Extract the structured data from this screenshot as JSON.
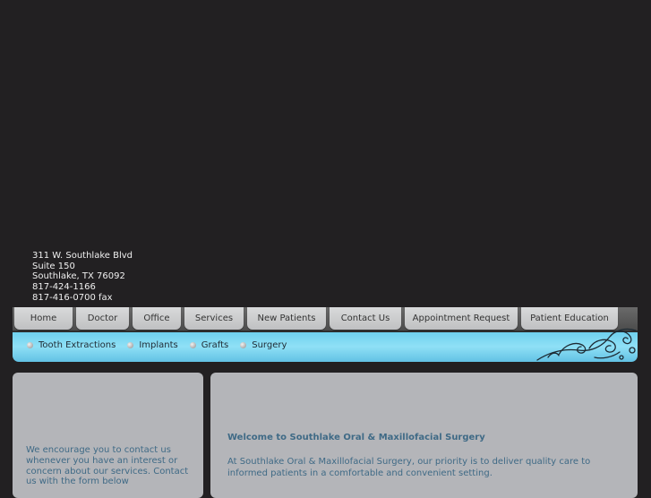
{
  "address": {
    "street": "311 W. Southlake Blvd",
    "suite": "Suite 150",
    "city": "Southlake, TX 76092",
    "phone": "817-424-1166",
    "fax": "817-416-0700 fax"
  },
  "nav": {
    "items": [
      "Home",
      "Doctor",
      "Office",
      "Services",
      "New Patients",
      "Contact Us",
      "Appointment Request",
      "Patient Education"
    ]
  },
  "subnav": {
    "items": [
      "Tooth Extractions",
      "Implants",
      "Grafts",
      "Surgery"
    ]
  },
  "left_panel": {
    "text": "We encourage you to contact us whenever you have an interest or concern about our services. Contact us with the form below"
  },
  "main": {
    "heading": "Welcome to Southlake Oral & Maxillofacial Surgery",
    "intro": "At Southlake Oral & Maxillofacial Surgery, our priority is to deliver quality care to informed patients in a comfortable and convenient setting."
  },
  "colors": {
    "page_background": "#222022",
    "accent_blue": "#8fe0f6",
    "panel_gray": "#b4b5b9",
    "text_blue": "#3f6a86"
  }
}
